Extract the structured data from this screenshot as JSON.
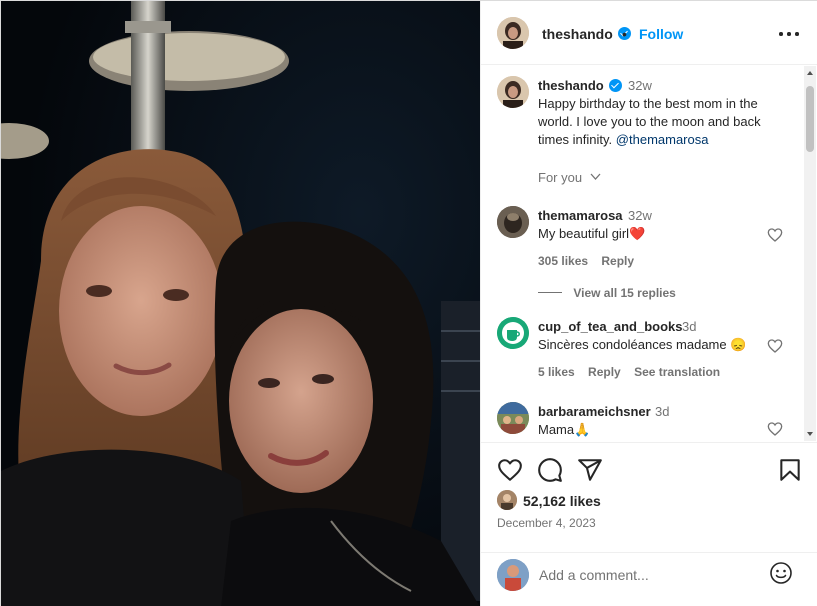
{
  "post": {
    "username": "theshando",
    "follow_label": "Follow",
    "separator": "•",
    "caption_time": "32w",
    "caption_text": "Happy birthday to the best mom in the world. I love you to the moon and back times infinity.",
    "caption_mention": "@themamarosa",
    "for_you_label": "For you"
  },
  "comments": [
    {
      "username": "themamarosa",
      "time": "32w",
      "text": "My beautiful girl❤️",
      "likes": "305 likes",
      "reply_label": "Reply",
      "view_replies": "View all 15 replies"
    },
    {
      "username": "cup_of_tea_and_books",
      "time": "3d",
      "text": "Sincères condoléances madame 😞",
      "likes": "5 likes",
      "reply_label": "Reply",
      "see_translation": "See translation"
    },
    {
      "username": "barbarameichsner",
      "time": "3d",
      "text": "Mama🙏"
    }
  ],
  "actions": {
    "likes_count": "52,162 likes",
    "date": "December 4, 2023"
  },
  "add_comment": {
    "placeholder": "Add a comment..."
  },
  "icons": {
    "more": "more-options-icon",
    "like": "heart-icon",
    "comment": "comment-icon",
    "share": "share-icon",
    "save": "bookmark-icon",
    "emoji": "emoji-icon",
    "verified": "verified-badge-icon"
  },
  "colors": {
    "accent": "#0095f6",
    "text": "#262626",
    "muted": "#737373",
    "heart": "#ed1c24"
  }
}
